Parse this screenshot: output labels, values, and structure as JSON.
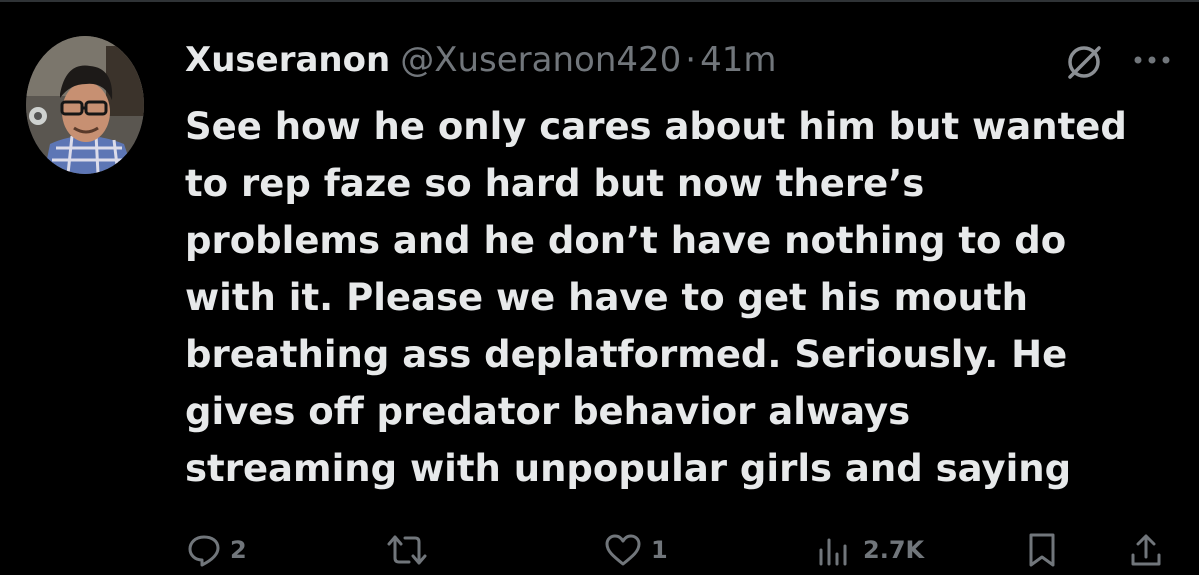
{
  "tweet": {
    "author": {
      "display_name": "Xuseranon",
      "handle": "@Xuseranon420",
      "separator": "·",
      "time": "41m"
    },
    "text_lines": [
      "See how he only cares about him but wanted",
      "to rep faze so hard but now there’s",
      "problems and he don’t have nothing to do",
      "with it. Please we have to get his mouth",
      "breathing ass deplatformed. Seriously. He",
      "gives off predator behavior always",
      "streaming with unpopular girls and saying"
    ],
    "actions": {
      "replies": {
        "icon": "reply-icon",
        "count": "2"
      },
      "reposts": {
        "icon": "repost-icon",
        "count": ""
      },
      "likes": {
        "icon": "like-icon",
        "count": "1"
      },
      "views": {
        "icon": "views-icon",
        "count": "2.7K"
      },
      "bookmark": {
        "icon": "bookmark-icon"
      },
      "share": {
        "icon": "share-icon"
      }
    },
    "header_icons": [
      "grok-icon",
      "more-icon"
    ]
  },
  "colors": {
    "background": "#000000",
    "primary_text": "#e7e9ea",
    "secondary_text": "#71767b",
    "divider": "#2f3336"
  }
}
